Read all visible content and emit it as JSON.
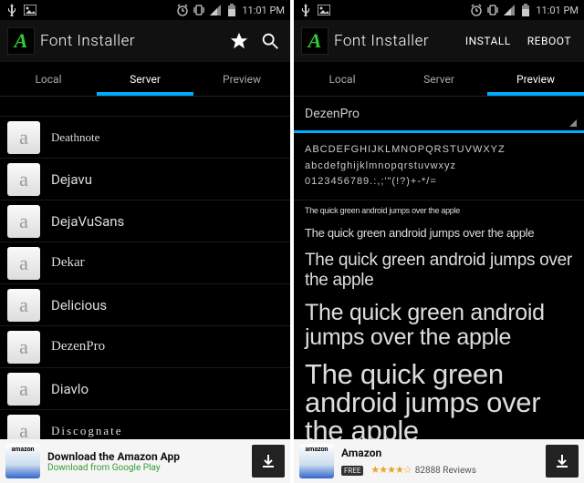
{
  "statusbar": {
    "time": "11:01 PM"
  },
  "app": {
    "logo_letter": "A",
    "title": "Font Installer"
  },
  "tabs": [
    "Local",
    "Server",
    "Preview"
  ],
  "left": {
    "active_tab": 1,
    "fonts": [
      "Deathnote",
      "Dejavu",
      "DejaVuSans",
      "Dekar",
      "Delicious",
      "DezenPro",
      "Diavlo",
      "Discognate"
    ]
  },
  "right": {
    "active_tab": 2,
    "buttons": {
      "install": "INSTALL",
      "reboot": "REBOOT"
    },
    "selected_font": "DezenPro",
    "alphabet": {
      "upper": "ABCDEFGHIJKLMNOPQRSTUVWXYZ",
      "lower": "abcdefghijklmnopqrstuvwxyz",
      "nums": "0123456789.:,;'\"(!?)+-*/="
    },
    "sample_text": "The quick green android jumps over the apple"
  },
  "ad_left": {
    "line1": "Download the Amazon App",
    "line2": "Download from Google Play"
  },
  "ad_right": {
    "title": "Amazon",
    "free": "FREE",
    "reviews": "82888 Reviews"
  }
}
